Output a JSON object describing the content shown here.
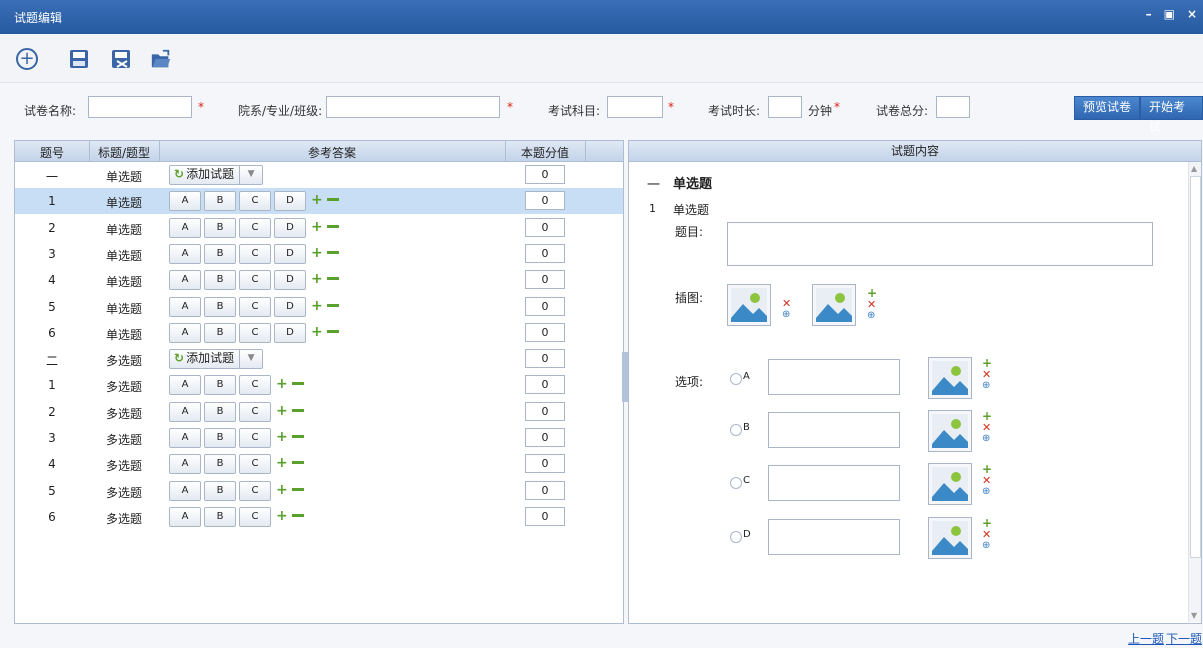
{
  "window": {
    "title": "试题编辑",
    "min": "–",
    "max": "▣",
    "close": "×"
  },
  "toolbar": {
    "add_icon": "add-circle-icon",
    "save_icon": "save-icon",
    "saveas_icon": "save-as-icon",
    "open_icon": "open-folder-icon"
  },
  "form": {
    "paper_name_label": "试卷名称:",
    "paper_name_value": "",
    "dept_label": "院系/专业/班级:",
    "dept_value": "",
    "subject_label": "考试科目:",
    "subject_value": "",
    "duration_label": "考试时长:",
    "duration_value": "",
    "duration_unit": "分钟",
    "total_label": "试卷总分:",
    "total_value": "",
    "required_mark": "*",
    "preview_button": "预览试卷",
    "start_button": "开始考试"
  },
  "table": {
    "headers": [
      "题号",
      "标题/题型",
      "参考答案",
      "本题分值"
    ],
    "add_question_label": "添加试题",
    "rows": [
      {
        "no": "一",
        "type": "单选题",
        "kind": "section",
        "score": "0"
      },
      {
        "no": "1",
        "type": "单选题",
        "kind": "q",
        "options": [
          "A",
          "B",
          "C",
          "D"
        ],
        "score": "0"
      },
      {
        "no": "2",
        "type": "单选题",
        "kind": "q",
        "options": [
          "A",
          "B",
          "C",
          "D"
        ],
        "score": "0"
      },
      {
        "no": "3",
        "type": "单选题",
        "kind": "q",
        "options": [
          "A",
          "B",
          "C",
          "D"
        ],
        "score": "0"
      },
      {
        "no": "4",
        "type": "单选题",
        "kind": "q",
        "options": [
          "A",
          "B",
          "C",
          "D"
        ],
        "score": "0"
      },
      {
        "no": "5",
        "type": "单选题",
        "kind": "q",
        "options": [
          "A",
          "B",
          "C",
          "D"
        ],
        "score": "0"
      },
      {
        "no": "6",
        "type": "单选题",
        "kind": "q",
        "options": [
          "A",
          "B",
          "C",
          "D"
        ],
        "score": "0"
      },
      {
        "no": "二",
        "type": "多选题",
        "kind": "section",
        "score": "0"
      },
      {
        "no": "1",
        "type": "多选题",
        "kind": "q",
        "options": [
          "A",
          "B",
          "C"
        ],
        "score": "0"
      },
      {
        "no": "2",
        "type": "多选题",
        "kind": "q",
        "options": [
          "A",
          "B",
          "C"
        ],
        "score": "0"
      },
      {
        "no": "3",
        "type": "多选题",
        "kind": "q",
        "options": [
          "A",
          "B",
          "C"
        ],
        "score": "0"
      },
      {
        "no": "4",
        "type": "多选题",
        "kind": "q",
        "options": [
          "A",
          "B",
          "C"
        ],
        "score": "0"
      },
      {
        "no": "5",
        "type": "多选题",
        "kind": "q",
        "options": [
          "A",
          "B",
          "C"
        ],
        "score": "0"
      },
      {
        "no": "6",
        "type": "多选题",
        "kind": "q",
        "options": [
          "A",
          "B",
          "C"
        ],
        "score": "0"
      }
    ],
    "selected_row": 1
  },
  "content": {
    "header": "试题内容",
    "section_no": "一",
    "section_title": "单选题",
    "q_no": "1",
    "q_type": "单选题",
    "stem_label": "题目:",
    "image_label": "插图:",
    "options_label": "选项:",
    "options": [
      "A",
      "B",
      "C",
      "D"
    ]
  },
  "nav": {
    "prev": "上一题",
    "next": "下一题"
  },
  "colors": {
    "accent": "#2f66b1",
    "selected_row": "#c7def5",
    "add_green": "#5aa02c",
    "delete_red": "#d3301e"
  }
}
